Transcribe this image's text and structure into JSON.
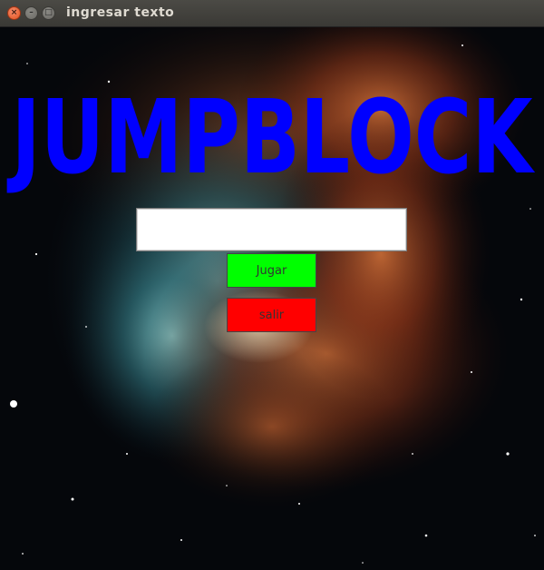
{
  "window": {
    "title": "ingresar texto",
    "close_glyph": "×",
    "minimize_glyph": "–",
    "maximize_glyph": "□"
  },
  "logo": {
    "text": "JUMPBLOCK",
    "color": "#0000ff"
  },
  "form": {
    "name_value": "",
    "play_label": "Jugar",
    "play_color": "#00ff00",
    "quit_label": "salir",
    "quit_color": "#ff0000"
  },
  "background": {
    "type": "space-nebula-image"
  }
}
